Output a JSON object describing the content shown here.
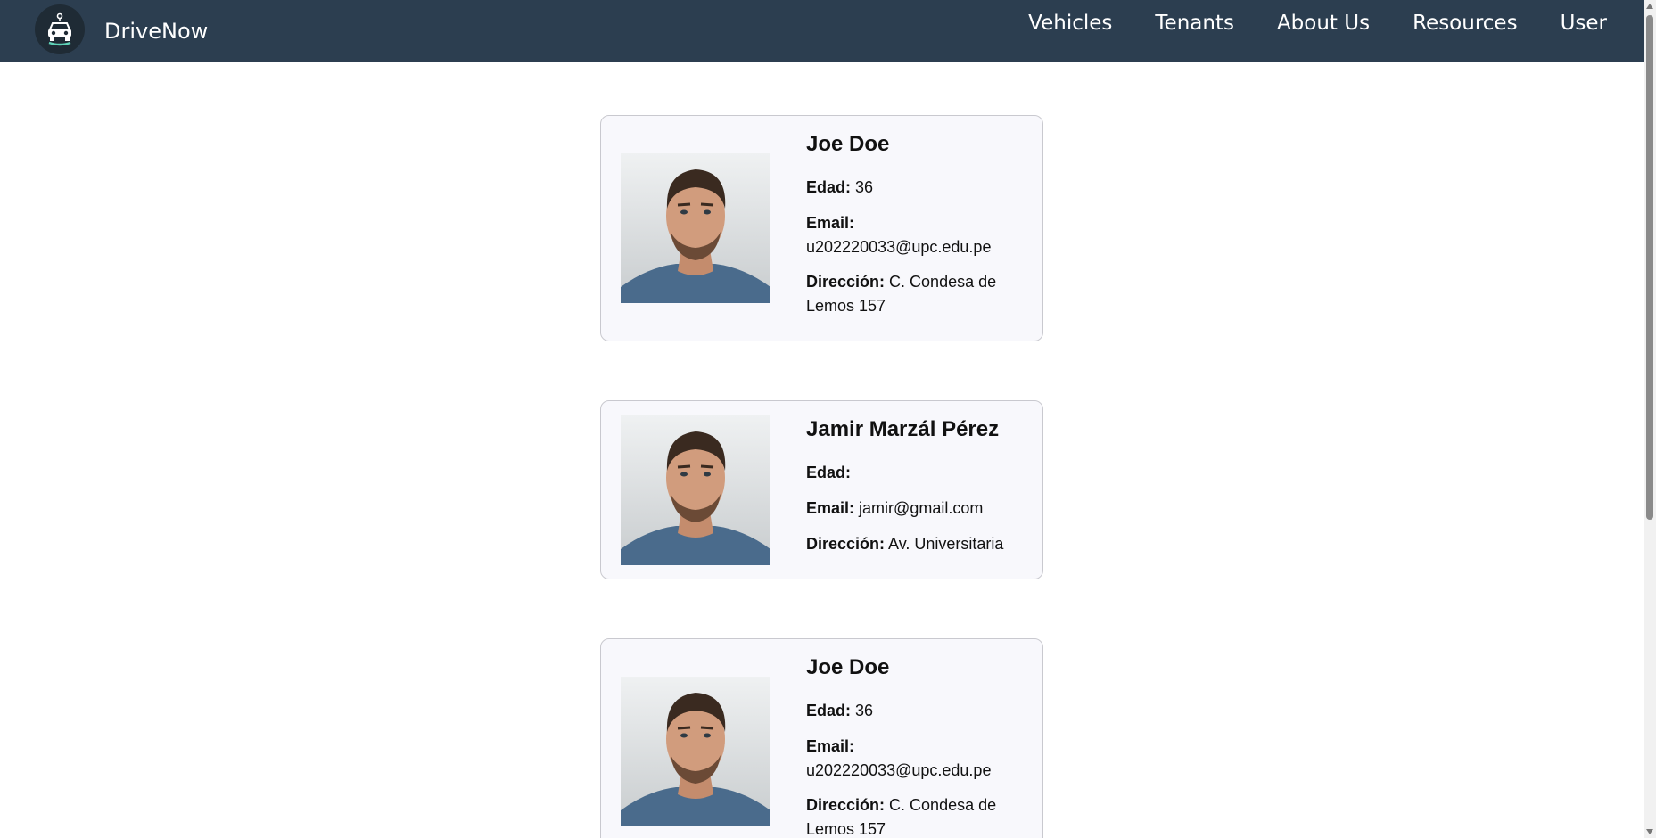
{
  "navbar": {
    "brand": "DriveNow",
    "links": [
      "Vehicles",
      "Tenants",
      "About Us",
      "Resources",
      "User"
    ]
  },
  "labels": {
    "age": "Edad:",
    "email": "Email:",
    "address": "Dirección:"
  },
  "tenants": [
    {
      "name": "Joe Doe",
      "age": "36",
      "email": "u202220033@upc.edu.pe",
      "address": "C. Condesa de Lemos 157"
    },
    {
      "name": "Jamir Marzál Pérez",
      "age": "",
      "email": "jamir@gmail.com",
      "address": "Av. Universitaria"
    },
    {
      "name": "Joe Doe",
      "age": "36",
      "email": "u202220033@upc.edu.pe",
      "address": "C. Condesa de Lemos 157"
    }
  ]
}
